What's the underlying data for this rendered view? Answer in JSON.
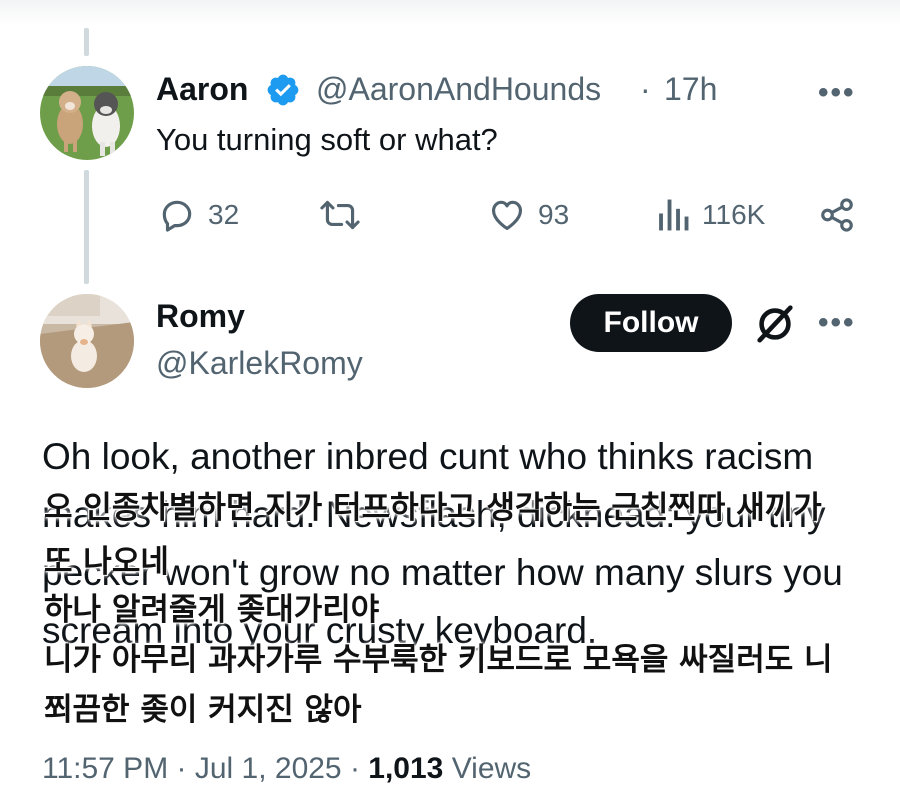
{
  "reply": {
    "display_name": "Aaron",
    "handle": "@AaronAndHounds",
    "separator": "·",
    "time": "17h",
    "more": "•••",
    "text": "You turning soft or what?",
    "actions": {
      "replies": "32",
      "reposts": "",
      "likes": "93",
      "views": "116K"
    }
  },
  "post": {
    "display_name": "Romy",
    "handle": "@KarlekRomy",
    "follow_label": "Follow",
    "more": "•••",
    "text": "Oh look, another inbred cunt who thinks racism makes him hard. Newsflash, dickhead: your tiny pecker won't grow no matter how many slurs you scream into your crusty keyboard.",
    "translation_overlay": [
      "오 인종차별하면 지가 터프하다고 생각하는 근친찐따 새끼가",
      "또 나오네",
      "하나 알려줄게 좆대가리야",
      "니가 아무리 과자가루 수부룩한 키보드로 모욕을 싸질러도 니",
      "쬐끔한 좆이 커지진 않아"
    ],
    "timestamp": "11:57 PM · Jul 1, 2025 · ",
    "views_count": "1,013",
    "views_label": " Views"
  },
  "icons": {
    "verified": "verified-badge-icon",
    "reply": "reply-icon",
    "repost": "repost-icon",
    "like": "heart-icon",
    "views": "views-icon",
    "share": "share-icon",
    "grok": "grok-icon"
  },
  "colors": {
    "verified_blue": "#1d9bf0",
    "text_primary": "#0f1419",
    "text_secondary": "#536471",
    "follow_bg": "#0f1419",
    "thread_line": "#cfd9de"
  }
}
